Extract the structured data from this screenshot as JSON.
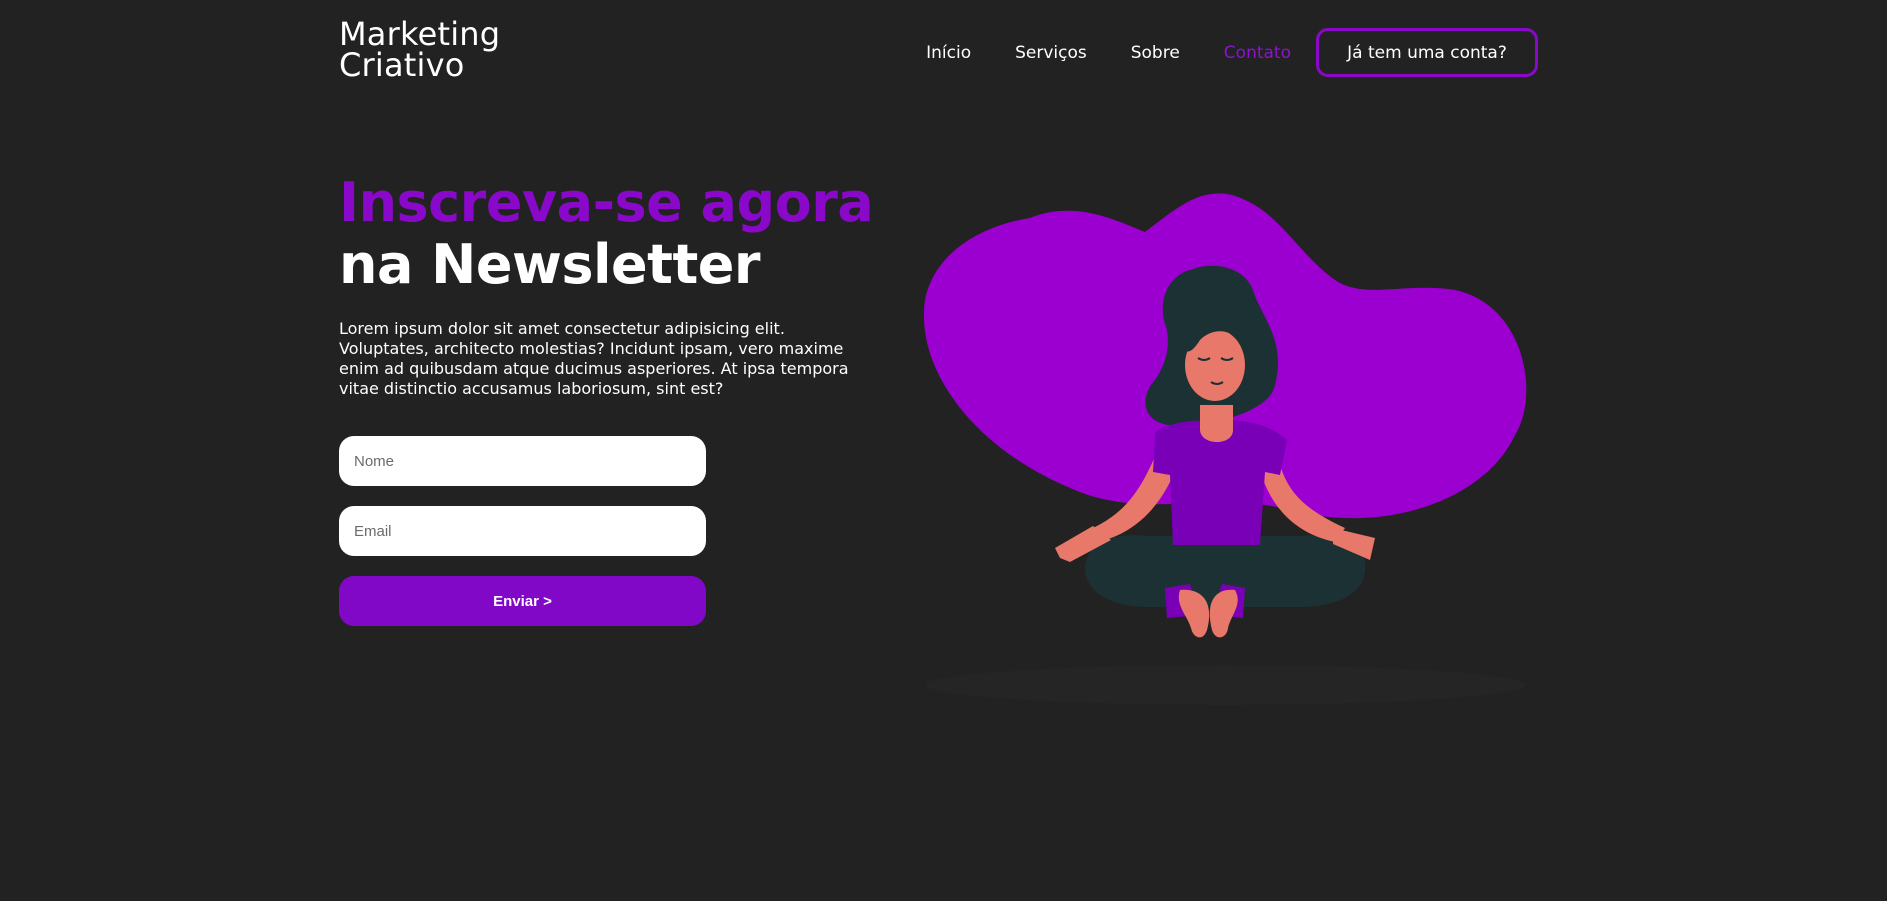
{
  "brand": {
    "line1": "Marketing",
    "line2": "Criativo"
  },
  "nav": {
    "items": [
      {
        "label": "Início"
      },
      {
        "label": "Serviços"
      },
      {
        "label": "Sobre"
      },
      {
        "label": "Contato",
        "active": true
      }
    ],
    "account_button": "Já tem uma conta?"
  },
  "hero": {
    "title_accent": "Inscreva-se agora",
    "title_main": "na Newsletter",
    "description": "Lorem ipsum dolor sit amet consectetur adipisicing elit. Voluptates, architecto molestias? Incidunt ipsam, vero maxime enim ad quibusdam atque ducimus asperiores. At ipsa tempora vitae distinctio accusamus laboriosum, sint est?"
  },
  "form": {
    "name_placeholder": "Nome",
    "email_placeholder": "Email",
    "submit_label": "Enviar >"
  },
  "illustration": {
    "icon": "meditating-woman-illustration"
  },
  "colors": {
    "background": "#222222",
    "accent": "#8a08c9",
    "blob": "#9b00d1",
    "text": "#ffffff"
  }
}
